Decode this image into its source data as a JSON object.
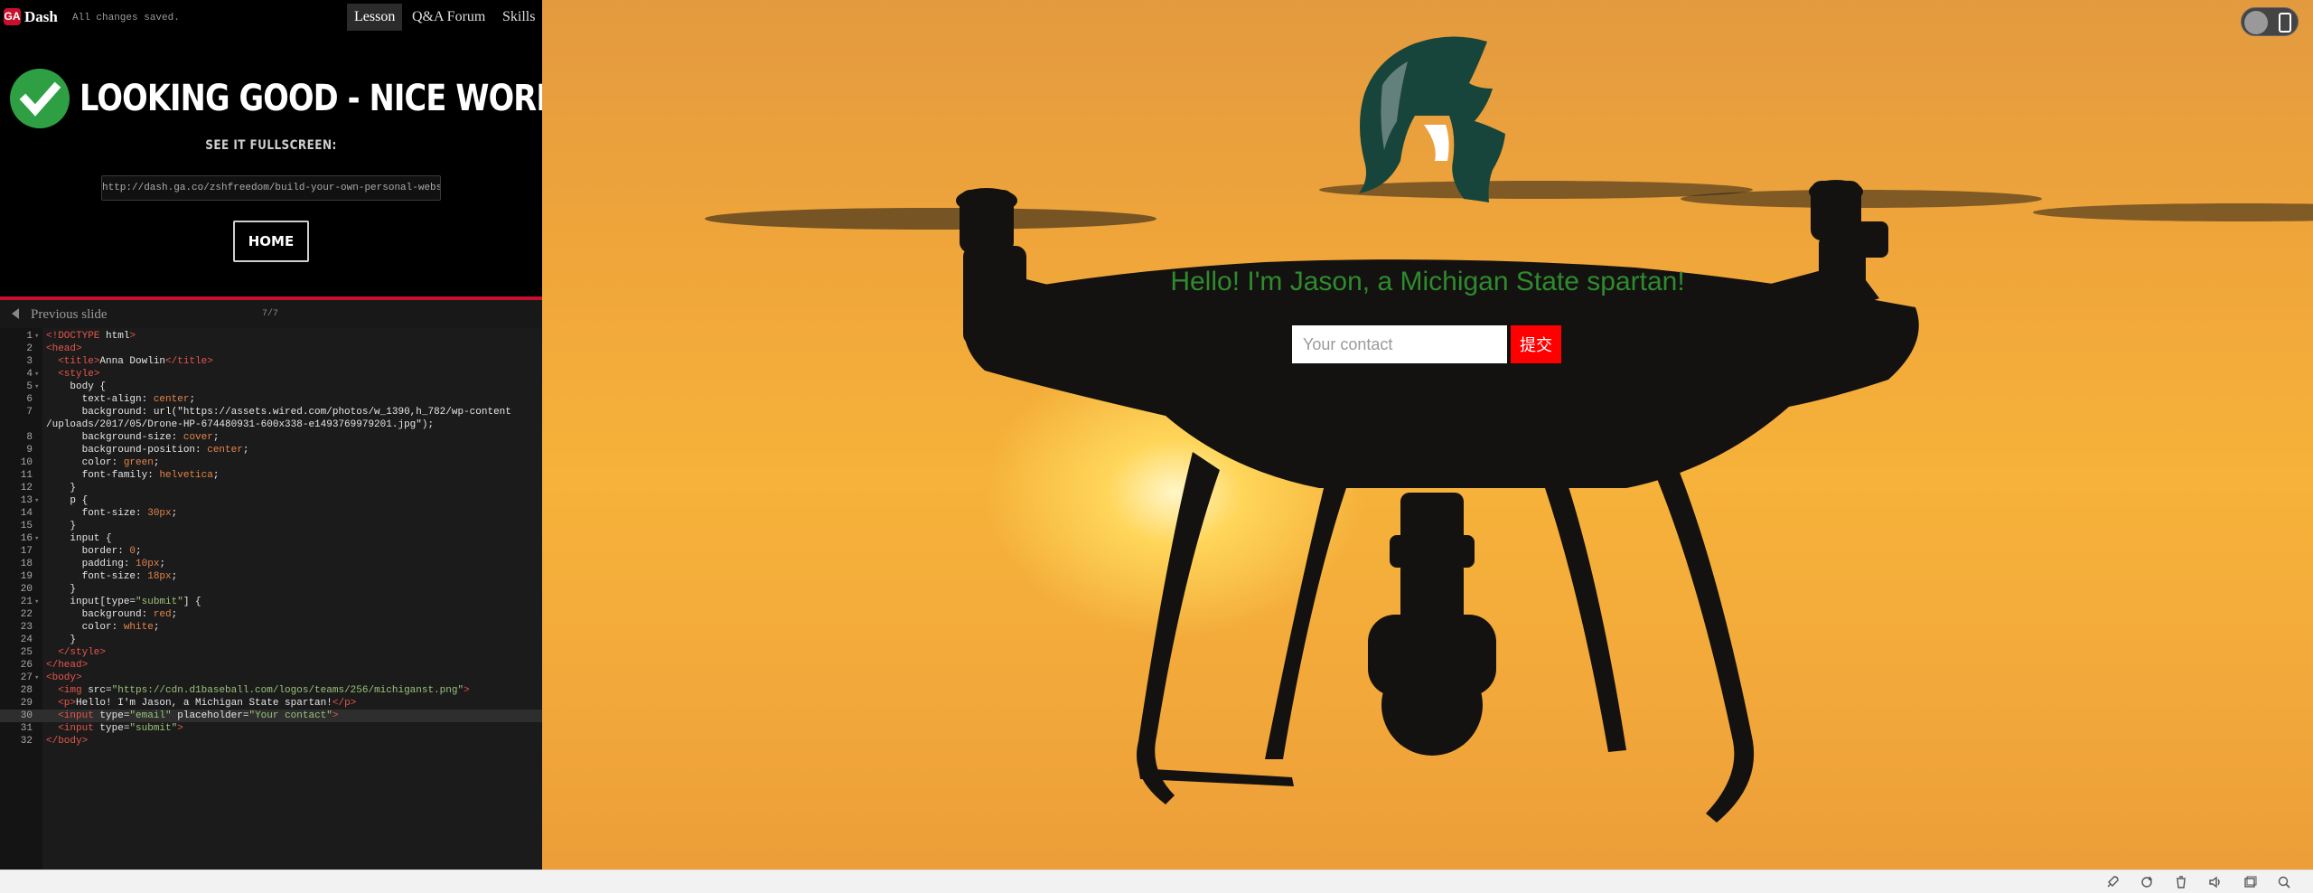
{
  "app": {
    "logo_text": "GA",
    "name": "Dash",
    "save_status": "All changes saved."
  },
  "nav": {
    "tabs": [
      "Lesson",
      "Q&A Forum",
      "Skills"
    ],
    "active": "Lesson"
  },
  "success": {
    "headline": "LOOKING GOOD - NICE WORK!",
    "fullscreen_label": "SEE IT FULLSCREEN:",
    "url": "http://dash.ga.co/zshfreedom/build-your-own-personal-website",
    "home_label": "HOME"
  },
  "slidebar": {
    "prev_label": "Previous slide",
    "count": "7/7"
  },
  "editor": {
    "current_line": 30,
    "lines": [
      "<!DOCTYPE html>",
      "<head>",
      "  <title>Anna Dowlin</title>",
      "  <style>",
      "    body {",
      "      text-align: center;",
      "      background: url(\"https://assets.wired.com/photos/w_1390,h_782/wp-content",
      "/uploads/2017/05/Drone-HP-674480931-600x338-e1493769979201.jpg\");",
      "      background-size: cover;",
      "      background-position: center;",
      "      color: green;",
      "      font-family: helvetica;",
      "    }",
      "    p {",
      "      font-size: 30px;",
      "    }",
      "    input {",
      "      border: 0;",
      "      padding: 10px;",
      "      font-size: 18px;",
      "    }",
      "    input[type=\"submit\"] {",
      "      background: red;",
      "      color: white;",
      "    }",
      "  </style>",
      "</head>",
      "<body>",
      "  <img src=\"https://cdn.d1baseball.com/logos/teams/256/michiganst.png\">",
      "  <p>Hello! I'm Jason, a Michigan State spartan!</p>",
      "  <input type=\"email\" placeholder=\"Your contact\">",
      "  <input type=\"submit\">",
      "</body>"
    ],
    "line_numbers": [
      "1",
      "2",
      "3",
      "4",
      "5",
      "6",
      "7",
      "",
      "8",
      "9",
      "10",
      "11",
      "12",
      "13",
      "14",
      "15",
      "16",
      "17",
      "18",
      "19",
      "20",
      "21",
      "22",
      "23",
      "24",
      "25",
      "26",
      "27",
      "28",
      "29",
      "30",
      "31",
      "32"
    ]
  },
  "preview": {
    "hello_text": "Hello! I'm Jason, a Michigan State spartan!",
    "contact_placeholder": "Your contact",
    "submit_label": "提交",
    "logo_color": "#18453b",
    "text_color": "#2e8b2e",
    "submit_color": "#ff0000"
  },
  "icons": [
    "check-icon",
    "arrow-left-icon",
    "phone-icon",
    "rocket-icon",
    "sync-icon",
    "trash-icon",
    "volume-icon",
    "window-icon",
    "search-icon"
  ]
}
